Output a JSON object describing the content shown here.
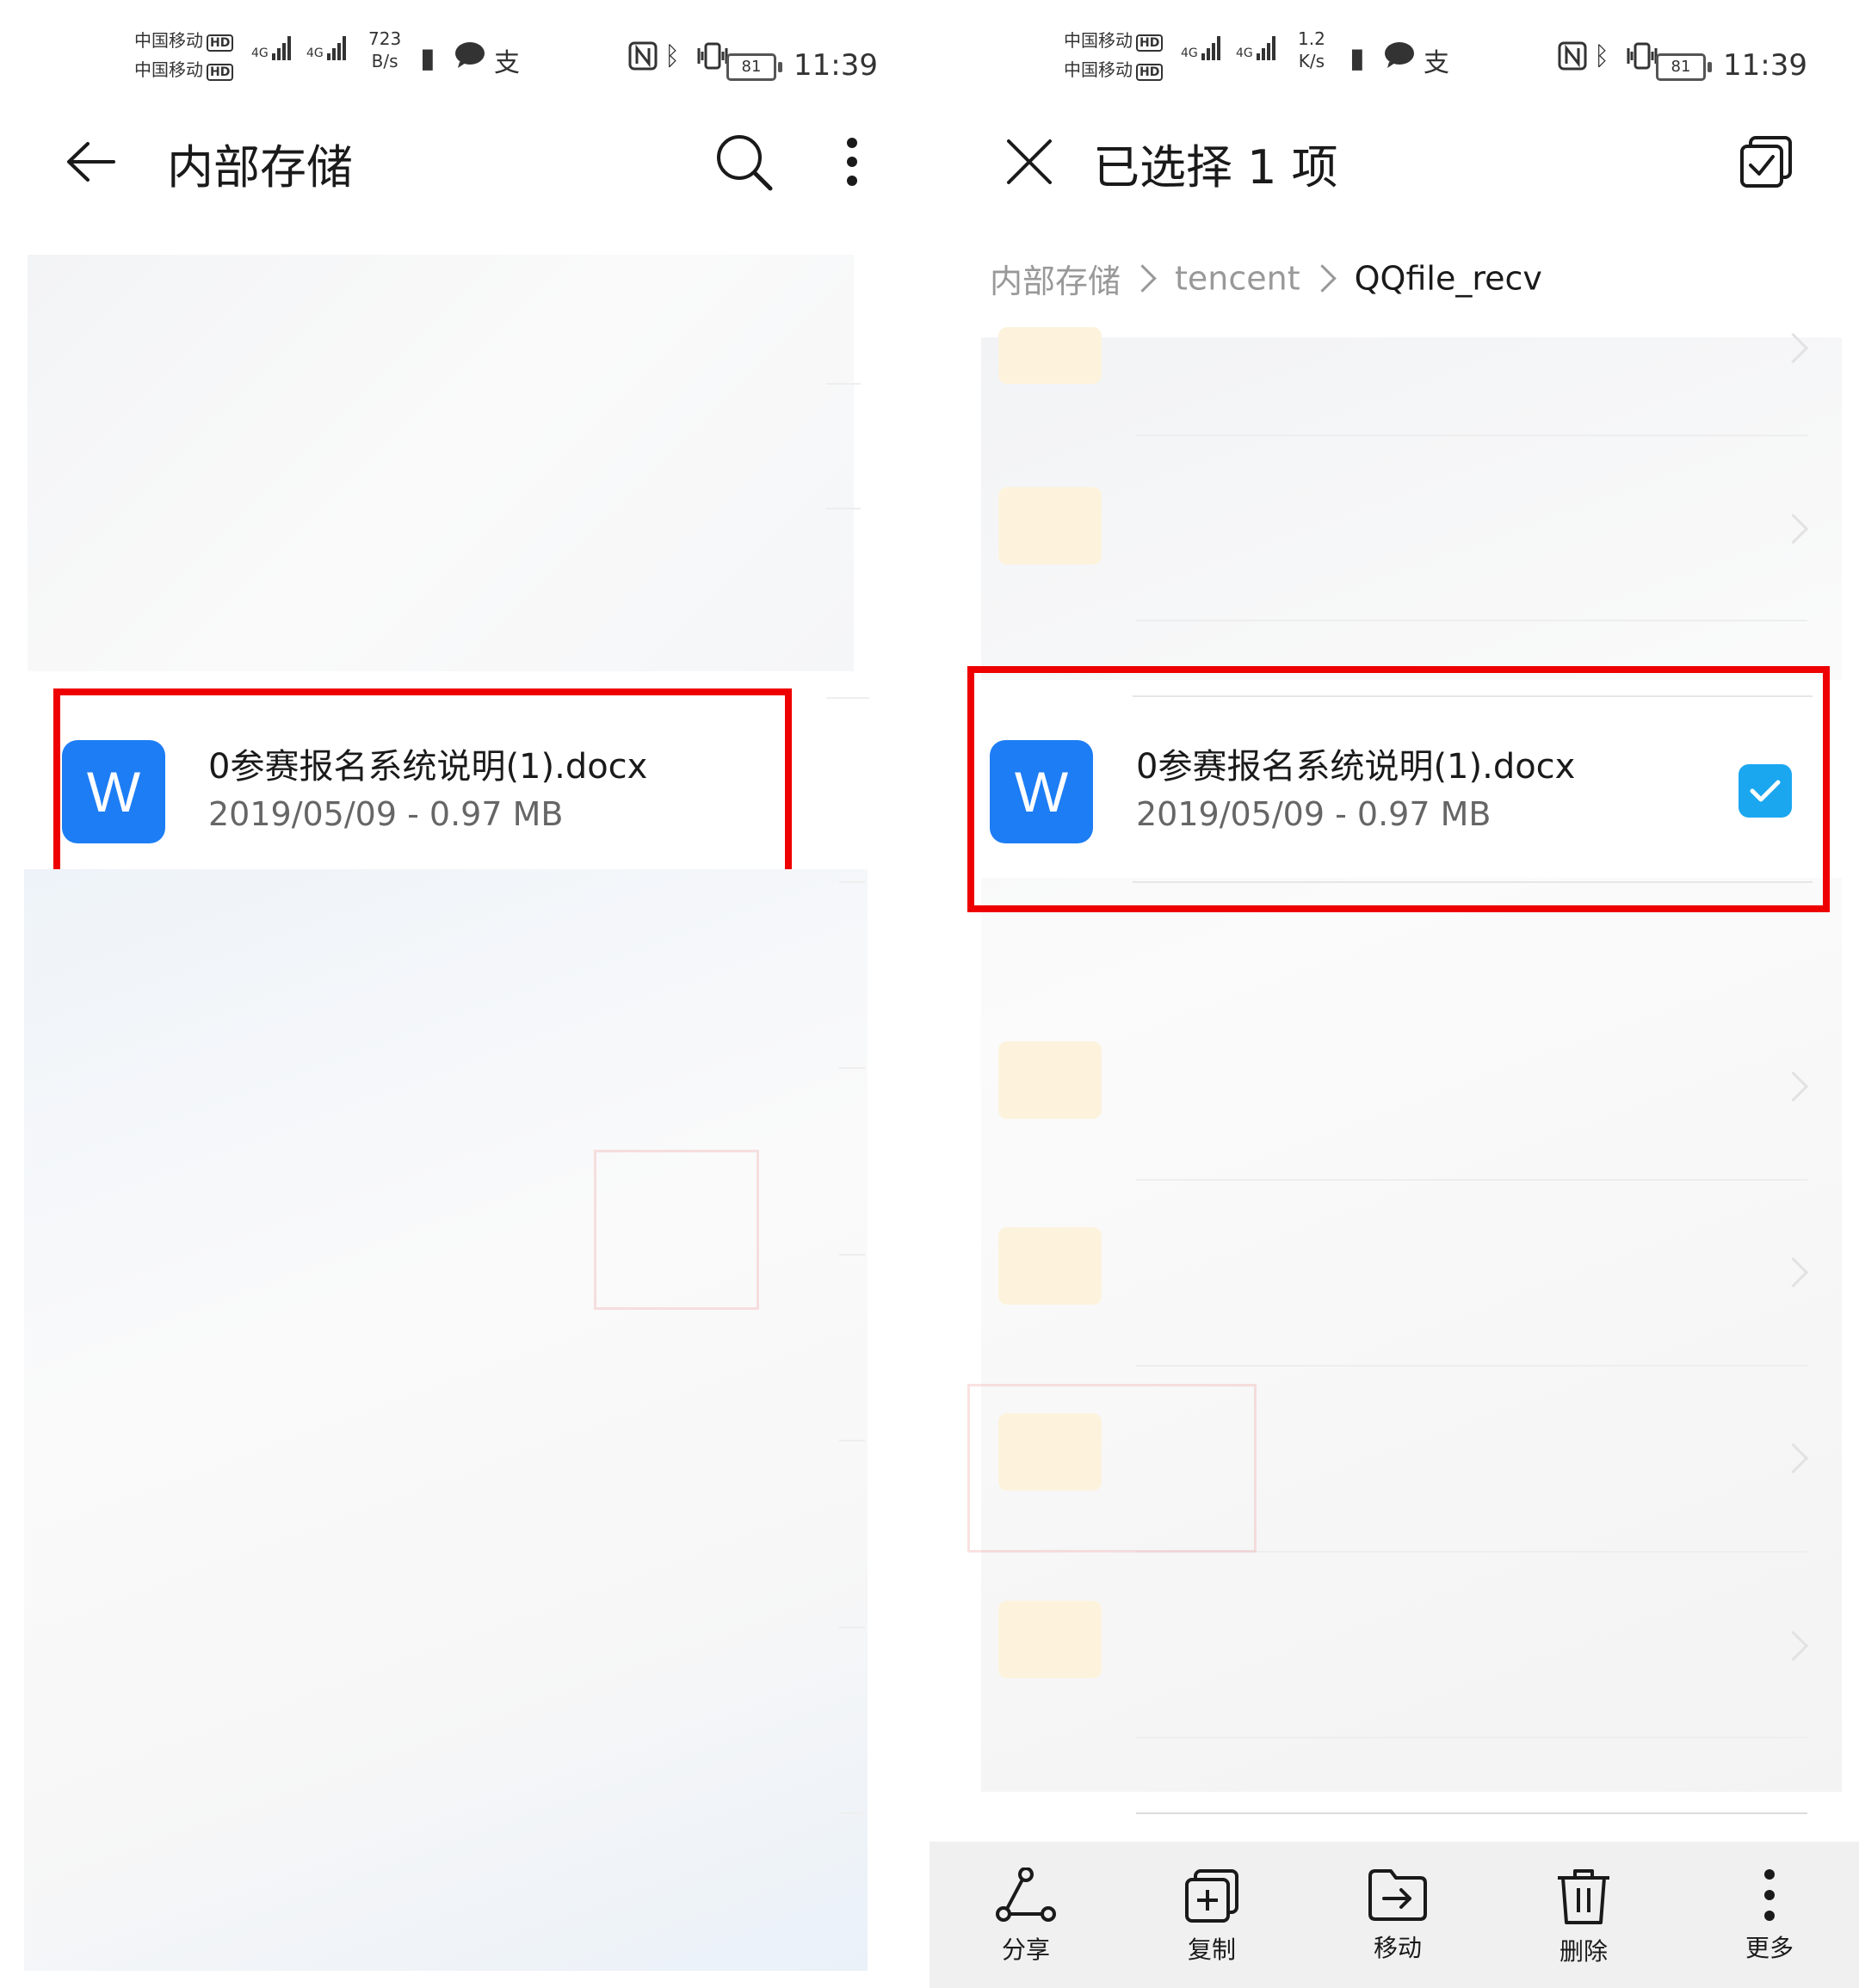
{
  "status": {
    "carrier_1": "中国移动",
    "carrier_2": "中国移动",
    "hd": "HD",
    "net_type": "4G",
    "left_speed_value": "723",
    "left_speed_unit": "B/s",
    "right_speed_value": "1.2",
    "right_speed_unit": "K/s",
    "battery": "81",
    "time": "11:39",
    "alipay_glyph": "支"
  },
  "left_screen": {
    "title": "内部存储",
    "file": {
      "name": "0参赛报名系统说明(1).docx",
      "meta": "2019/05/09 - 0.97 MB",
      "icon_letter": "W"
    }
  },
  "right_screen": {
    "title": "已选择 1 项",
    "breadcrumb": [
      "内部存储",
      "tencent",
      "QQfile_recv"
    ],
    "file": {
      "name": "0参赛报名系统说明(1).docx",
      "meta": "2019/05/09 - 0.97 MB",
      "icon_letter": "W",
      "checked": true
    },
    "bottom_bar": [
      {
        "label": "分享",
        "icon": "share-icon"
      },
      {
        "label": "复制",
        "icon": "copy-icon"
      },
      {
        "label": "移动",
        "icon": "move-icon"
      },
      {
        "label": "删除",
        "icon": "delete-icon"
      },
      {
        "label": "更多",
        "icon": "more-icon"
      }
    ]
  },
  "colors": {
    "accent_blue": "#1d7df5",
    "checkbox_blue": "#1aa7f0",
    "highlight_red": "#ee0000"
  }
}
